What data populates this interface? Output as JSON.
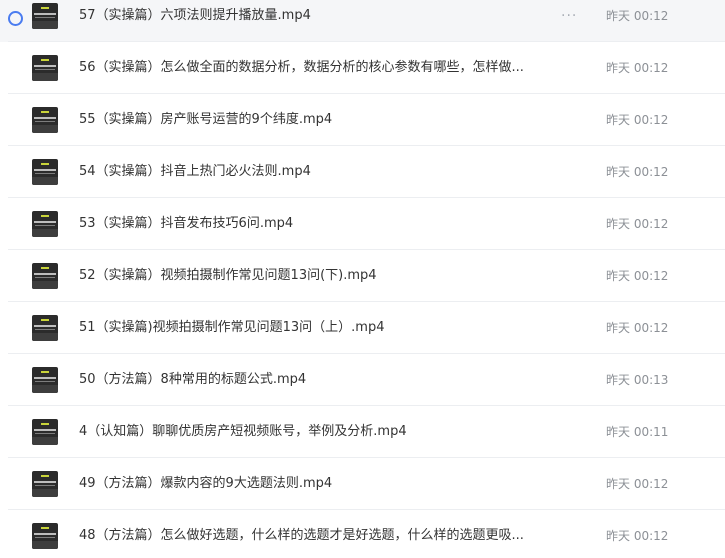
{
  "files": [
    {
      "name": "57（实操篇）六项法则提升播放量.mp4",
      "time": "昨天 00:12",
      "selected": true
    },
    {
      "name": "56（实操篇）怎么做全面的数据分析，数据分析的核心参数有哪些，怎样做...",
      "time": "昨天 00:12"
    },
    {
      "name": "55（实操篇）房产账号运营的9个纬度.mp4",
      "time": "昨天 00:12"
    },
    {
      "name": "54（实操篇）抖音上热门必火法则.mp4",
      "time": "昨天 00:12"
    },
    {
      "name": "53（实操篇）抖音发布技巧6问.mp4",
      "time": "昨天 00:12"
    },
    {
      "name": "52（实操篇）视频拍摄制作常见问题13问(下).mp4",
      "time": "昨天 00:12"
    },
    {
      "name": "51（实操篇)视频拍摄制作常见问题13问（上）.mp4",
      "time": "昨天 00:12"
    },
    {
      "name": "50（方法篇）8种常用的标题公式.mp4",
      "time": "昨天 00:13"
    },
    {
      "name": "4（认知篇）聊聊优质房产短视频账号，举例及分析.mp4",
      "time": "昨天 00:11"
    },
    {
      "name": "49（方法篇）爆款内容的9大选题法则.mp4",
      "time": "昨天 00:12"
    },
    {
      "name": "48（方法篇）怎么做好选题，什么样的选题才是好选题，什么样的选题更吸...",
      "time": "昨天 00:12"
    }
  ],
  "more_label": "···",
  "icons": {
    "check": "circle-select-icon",
    "thumbnail": "video-thumbnail",
    "more": "more-options-icon"
  },
  "colors": {
    "accent": "#4a7cf0",
    "selected_row_bg": "#f5f6f8",
    "text": "#333333",
    "time_text": "#8c9096"
  }
}
